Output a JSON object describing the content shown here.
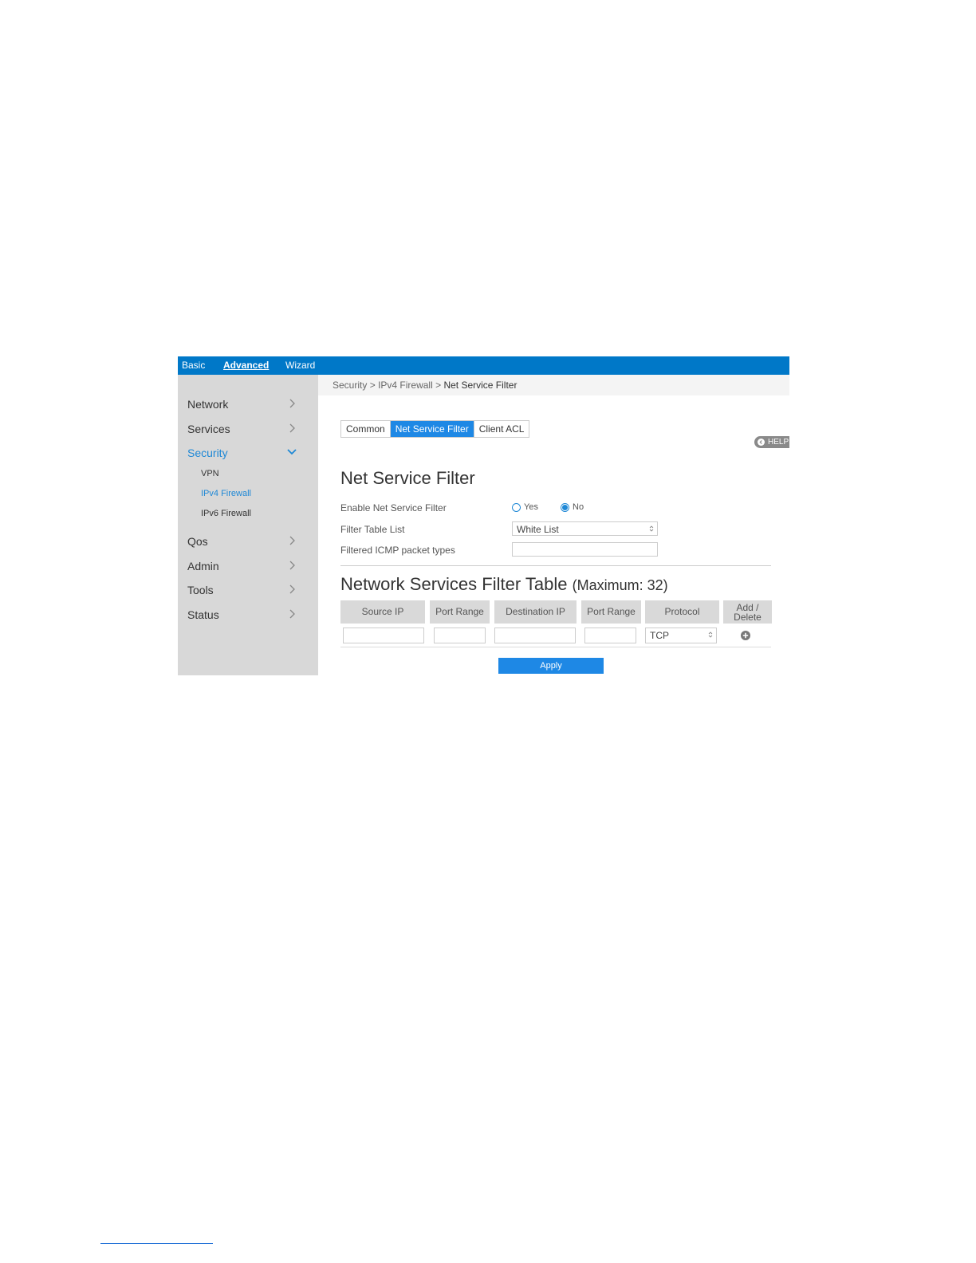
{
  "topbar": {
    "tabs": [
      {
        "label": "Basic",
        "active": false
      },
      {
        "label": "Advanced",
        "active": true
      },
      {
        "label": "Wizard",
        "active": false
      }
    ]
  },
  "sidebar": {
    "items": [
      {
        "label": "Network",
        "icon": "chevron-right-icon"
      },
      {
        "label": "Services",
        "icon": "chevron-right-icon"
      },
      {
        "label": "Security",
        "icon": "chevron-down-icon",
        "active": true,
        "children": [
          {
            "label": "VPN"
          },
          {
            "label": "IPv4 Firewall",
            "active": true
          },
          {
            "label": "IPv6 Firewall"
          }
        ]
      },
      {
        "label": "Qos",
        "icon": "chevron-right-icon"
      },
      {
        "label": "Admin",
        "icon": "chevron-right-icon"
      },
      {
        "label": "Tools",
        "icon": "chevron-right-icon"
      },
      {
        "label": "Status",
        "icon": "chevron-right-icon"
      }
    ]
  },
  "breadcrumb": {
    "parts": [
      "Security",
      "IPv4 Firewall",
      "Net Service Filter"
    ],
    "separator": ">"
  },
  "tabs": [
    {
      "label": "Common",
      "active": false
    },
    {
      "label": "Net Service Filter",
      "active": true
    },
    {
      "label": "Client ACL",
      "active": false
    }
  ],
  "help": {
    "label": "HELP"
  },
  "form": {
    "title": "Net Service Filter",
    "enable_label": "Enable Net Service Filter",
    "enable_options": [
      {
        "label": "Yes",
        "checked": false
      },
      {
        "label": "No",
        "checked": true
      }
    ],
    "filter_table_label": "Filter Table List",
    "filter_table_value": "White List",
    "icmp_label": "Filtered ICMP packet types",
    "icmp_value": ""
  },
  "table": {
    "title": "Network Services Filter Table",
    "max_note": "(Maximum: 32)",
    "headers": [
      "Source IP",
      "Port Range",
      "Destination IP",
      "Port Range",
      "Protocol",
      "Add / Delete"
    ],
    "new_row": {
      "source_ip": "",
      "source_port_range": "",
      "destination_ip": "",
      "destination_port_range": "",
      "protocol": "TCP"
    }
  },
  "apply_label": "Apply",
  "colors": {
    "accent": "#1e88e5",
    "topbar": "#0078c8",
    "sidebar": "#d8d8d8"
  }
}
